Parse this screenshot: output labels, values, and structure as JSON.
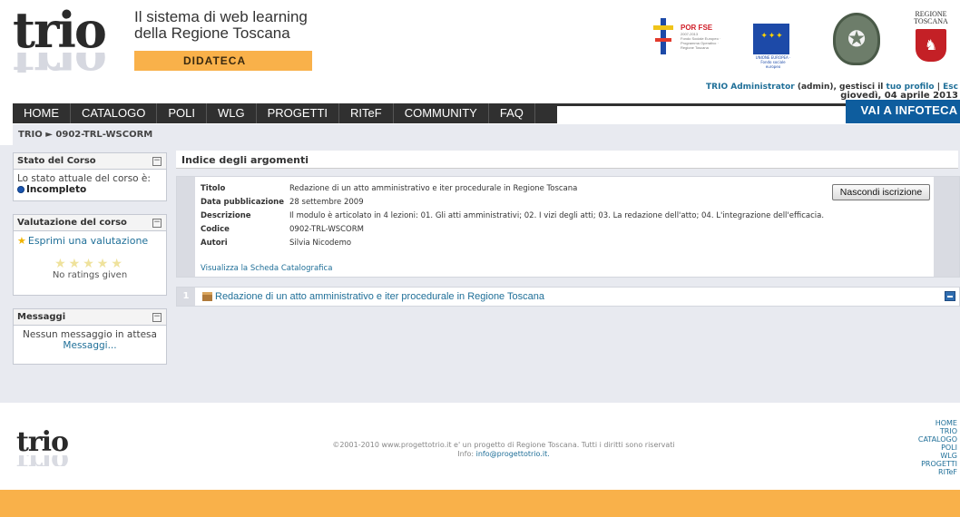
{
  "header": {
    "logo_text": "trio",
    "tagline_line1": "Il sistema di web learning",
    "tagline_line2": "della Regione Toscana",
    "section_badge": "DIDATECA",
    "partners": {
      "por_fse": "POR FSE",
      "por_years": "2007-2013",
      "por_sub": "Fondo Sociale Europeo · Programma Operativo · Regione Toscana",
      "eu_caption": "UNIONE EUROPEA · Fondo sociale europeo",
      "regione_line1": "REGIONE",
      "regione_line2": "TOSCANA"
    },
    "user": {
      "name": "TRIO Administrator",
      "role": "(admin), gestisci il",
      "profile_link": "tuo profilo",
      "separator": "|",
      "logout_link": "Esc",
      "date": "giovedì, 04 aprile 2013"
    }
  },
  "nav": {
    "items": [
      "HOME",
      "CATALOGO",
      "POLI",
      "WLG",
      "PROGETTI",
      "RITeF",
      "COMMUNITY",
      "FAQ"
    ],
    "infoteca": "VAI A INFOTECA"
  },
  "breadcrumb": "TRIO ► 0902-TRL-WSCORM",
  "sidebar": {
    "stato": {
      "title": "Stato del Corso",
      "text": "Lo stato attuale del corso è:",
      "status": "Incompleto"
    },
    "valutazione": {
      "title": "Valutazione del corso",
      "rate_link": "Esprimi una valutazione",
      "stars": "★★★★★",
      "no_ratings": "No ratings given"
    },
    "messaggi": {
      "title": "Messaggi",
      "text": "Nessun messaggio in attesa",
      "link": "Messaggi..."
    }
  },
  "main": {
    "title": "Indice degli argomenti",
    "course": {
      "rows": [
        {
          "key": "Titolo",
          "value": "Redazione di un atto amministrativo e iter procedurale in Regione Toscana"
        },
        {
          "key": "Data pubblicazione",
          "value": "28 settembre 2009"
        },
        {
          "key": "Descrizione",
          "value": "Il modulo è articolato in 4 lezioni: 01. Gli atti amministrativi; 02. I vizi degli atti; 03. La redazione dell'atto; 04. L'integrazione dell'efficacia."
        },
        {
          "key": "Codice",
          "value": "0902-TRL-WSCORM"
        },
        {
          "key": "Autori",
          "value": "Silvia Nicodemo"
        }
      ],
      "catalog_link": "Visualizza la Scheda Catalografica",
      "unsubscribe_button": "Nascondi iscrizione"
    },
    "module": {
      "number": "1",
      "title": "Redazione di un atto amministrativo e iter procedurale in Regione Toscana"
    }
  },
  "footer": {
    "copyright": "©2001-2010 www.progettotrio.it e' un progetto di Regione Toscana. Tutti i diritti sono riservati",
    "info_label": "Info:",
    "info_email": "info@progettotrio.it.",
    "links": [
      "HOME",
      "TRIO",
      "CATALOGO",
      "POLI",
      "WLG",
      "PROGETTI",
      "RITeF"
    ]
  },
  "colors": {
    "accent_orange": "#f9b14a",
    "nav_dark": "#303030",
    "infoteca_blue": "#0e5d9e",
    "link_blue": "#1f6f98",
    "panel_bg": "#e8eaf0"
  }
}
